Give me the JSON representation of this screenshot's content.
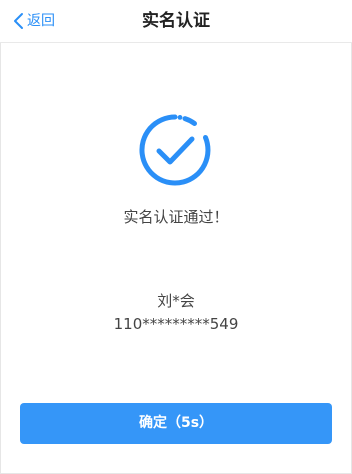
{
  "nav": {
    "back_label": "返回",
    "back_icon": "chevron-left-icon",
    "title": "实名认证"
  },
  "status": {
    "icon": "check-circle-icon",
    "message": "实名认证通过！"
  },
  "identity": {
    "name": "刘*会",
    "id_number": "110*********549"
  },
  "confirm": {
    "label": "确定（5s）"
  },
  "colors": {
    "accent": "#2a8ff7",
    "button": "#3596f8"
  }
}
